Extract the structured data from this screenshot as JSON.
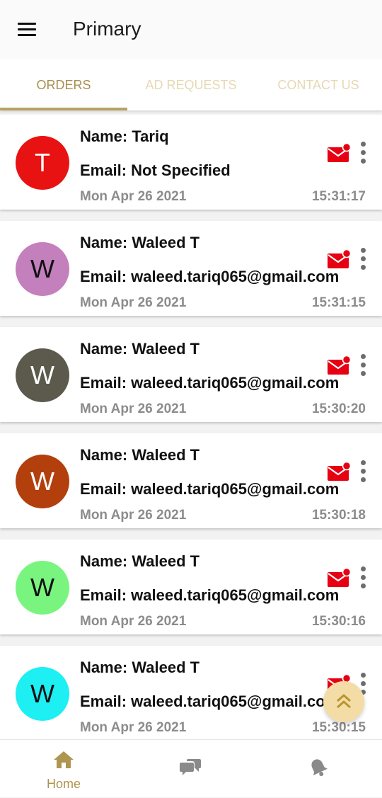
{
  "app": {
    "title": "Primary"
  },
  "tabs": [
    {
      "label": "ORDERS",
      "active": true
    },
    {
      "label": "AD REQUESTS",
      "active": false
    },
    {
      "label": "CONTACT US",
      "active": false
    }
  ],
  "messages": [
    {
      "initial": "T",
      "avatar_color": "#e81212",
      "initial_color": "#ffffff",
      "name": "Name: Tariq",
      "email": "Email: Not Specified",
      "date": "Mon Apr 26 2021",
      "time": "15:31:17"
    },
    {
      "initial": "W",
      "avatar_color": "#c47fbd",
      "initial_color": "#111111",
      "name": "Name: Waleed T",
      "email": "Email: waleed.tariq065@gmail.com",
      "date": "Mon Apr 26 2021",
      "time": "15:31:15"
    },
    {
      "initial": "W",
      "avatar_color": "#5b5a4c",
      "initial_color": "#ffffff",
      "name": "Name: Waleed T",
      "email": "Email: waleed.tariq065@gmail.com",
      "date": "Mon Apr 26 2021",
      "time": "15:30:20"
    },
    {
      "initial": "W",
      "avatar_color": "#b33f0d",
      "initial_color": "#ffffff",
      "name": "Name: Waleed T",
      "email": "Email: waleed.tariq065@gmail.com",
      "date": "Mon Apr 26 2021",
      "time": "15:30:18"
    },
    {
      "initial": "W",
      "avatar_color": "#79f57f",
      "initial_color": "#111111",
      "name": "Name: Waleed T",
      "email": "Email: waleed.tariq065@gmail.com",
      "date": "Mon Apr 26 2021",
      "time": "15:30:16"
    },
    {
      "initial": "W",
      "avatar_color": "#1deff3",
      "initial_color": "#111111",
      "name": "Name: Waleed T",
      "email": "Email: waleed.tariq065@gmail.com",
      "date": "Mon Apr 26 2021",
      "time": "15:30:15"
    }
  ],
  "icons": {
    "menu": "hamburger-menu-icon",
    "mail": "unread-mail-icon",
    "more": "more-vertical-icon",
    "scroll_top": "double-chevron-up-icon"
  },
  "colors": {
    "accent": "#ae9550",
    "mail_red": "#e60012",
    "tab_inactive": "#e7d8b3"
  },
  "bottom_nav": [
    {
      "label": "Home",
      "icon": "home-icon",
      "active": true
    },
    {
      "label": "",
      "icon": "chat-icon",
      "active": false
    },
    {
      "label": "",
      "icon": "bell-icon",
      "active": false
    }
  ]
}
